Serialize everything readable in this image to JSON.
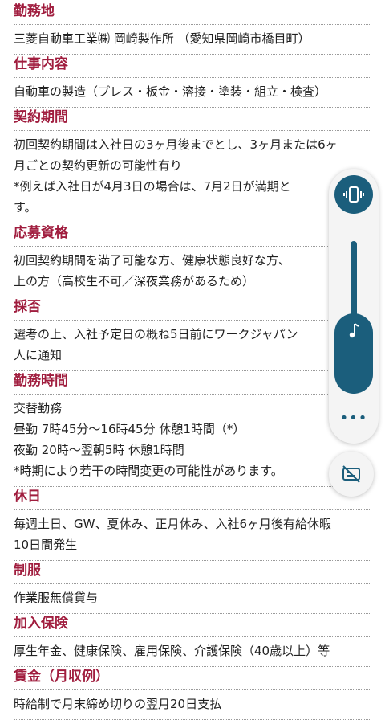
{
  "sections": [
    {
      "heading": "勤務地",
      "lines": [
        "三菱自動車工業㈱ 岡崎製作所 （愛知県岡崎市橋目町）"
      ]
    },
    {
      "heading": "仕事内容",
      "lines": [
        "自動車の製造（プレス・板金・溶接・塗装・組立・検査）"
      ]
    },
    {
      "heading": "契約期間",
      "lines": [
        "初回契約期間は入社日の3ヶ月後までとし、3ヶ月または6ヶ",
        "月ごとの契約更新の可能性有り",
        "*例えば入社日が4月3日の場合は、7月2日が満期と",
        "す。"
      ]
    },
    {
      "heading": "応募資格",
      "lines": [
        "初回契約期間を満了可能な方、健康状態良好な方、",
        "上の方（高校生不可／深夜業務があるため）"
      ]
    },
    {
      "heading": "採否",
      "lines": [
        "選考の上、入社予定日の概ね5日前にワークジャパン",
        "人に通知"
      ]
    },
    {
      "heading": "勤務時間",
      "lines": [
        "交替勤務",
        "昼勤 7時45分〜16時45分 休憩1時間（*）",
        "夜勤 20時〜翌朝5時 休憩1時間",
        "*時期により若干の時間変更の可能性があります。"
      ]
    },
    {
      "heading": "休日",
      "lines": [
        "毎週土日、GW、夏休み、正月休み、入社6ヶ月後有給休暇",
        "10日間発生"
      ]
    },
    {
      "heading": "制服",
      "lines": [
        "作業服無償貸与"
      ]
    },
    {
      "heading": "加入保険",
      "lines": [
        "厚生年金、健康保険、雇用保険、介護保険（40歳以上）等"
      ]
    },
    {
      "heading": "賃金（月収例）",
      "lines": [
        "時給制で月末締め切りの翌月20日支払"
      ]
    }
  ],
  "volume_panel": {
    "ringer_mode_icon": "vibrate-icon",
    "stream_icon": "music-note-icon",
    "more_icon": "more-horizontal-icon",
    "caption_icon": "captions-off-icon",
    "level": 0.53,
    "more_label": "•••",
    "accent": "#1b5e7c"
  },
  "colors": {
    "heading": "#a01d3e",
    "text": "#222222"
  }
}
